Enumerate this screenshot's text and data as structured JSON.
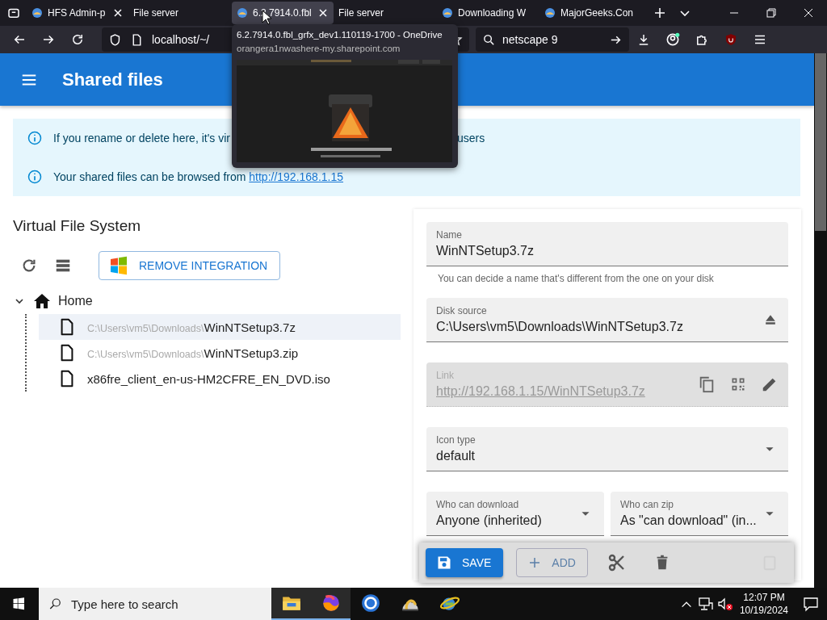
{
  "browser": {
    "tabs": [
      {
        "label": "HFS Admin-p",
        "selected": false,
        "closable": true,
        "favicon": true
      },
      {
        "label": "File server",
        "selected": false,
        "closable": false,
        "favicon": false
      },
      {
        "label": "6.2.7914.0.fbl",
        "selected": true,
        "closable": true,
        "favicon": true
      },
      {
        "label": "File server",
        "selected": false,
        "closable": false,
        "favicon": false
      },
      {
        "label": "Downloading W",
        "selected": false,
        "closable": false,
        "favicon": true
      },
      {
        "label": "MajorGeeks.Con",
        "selected": false,
        "closable": false,
        "favicon": true
      }
    ],
    "url": "localhost/~/",
    "search": "netscape 9",
    "tooltip": {
      "title": "6.2.7914.0.fbl_grfx_dev1.110119-1700 - OneDrive",
      "url": "orangera1nwashere-my.sharepoint.com"
    }
  },
  "app": {
    "title": "Shared files",
    "alerts": [
      {
        "text": "If you rename or delete here, it's vir",
        "tail": "users"
      },
      {
        "text": "Your shared files can be browsed from",
        "link": "http://192.168.1.15"
      }
    ],
    "vfs": {
      "title": "Virtual File System",
      "integration_button": "REMOVE INTEGRATION",
      "tree": {
        "label": "Home",
        "expanded": true,
        "children": [
          {
            "dir": "C:\\Users\\vm5\\Downloads\\",
            "name": "WinNTSetup3.7z",
            "selected": true
          },
          {
            "dir": "C:\\Users\\vm5\\Downloads\\",
            "name": "WinNTSetup3.zip",
            "selected": false
          },
          {
            "name": "x86fre_client_en-us-HM2CFRE_EN_DVD.iso",
            "selected": false
          }
        ]
      }
    },
    "form": {
      "fields": [
        {
          "kind": "text",
          "label": "Name",
          "value": "WinNTSetup3.7z",
          "helper": "You can decide a name that's different from the one on your disk"
        },
        {
          "kind": "source",
          "label": "Disk source",
          "value": "C:\\Users\\vm5\\Downloads\\WinNTSetup3.7z"
        },
        {
          "kind": "link",
          "label": "Link",
          "value": "http://192.168.1.15/WinNTSetup3.7z",
          "disabled": true
        },
        {
          "kind": "select",
          "label": "Icon type",
          "value": "default"
        }
      ],
      "pair": [
        {
          "label": "Who can download",
          "value": "Anyone (inherited)"
        },
        {
          "label": "Who can zip",
          "value": "As \"can download\" (in..."
        }
      ]
    },
    "actions": {
      "save": "SAVE",
      "add": "ADD"
    }
  },
  "taskbar": {
    "search_placeholder": "Type here to search",
    "time": "12:07 PM",
    "date": "10/19/2024"
  }
}
